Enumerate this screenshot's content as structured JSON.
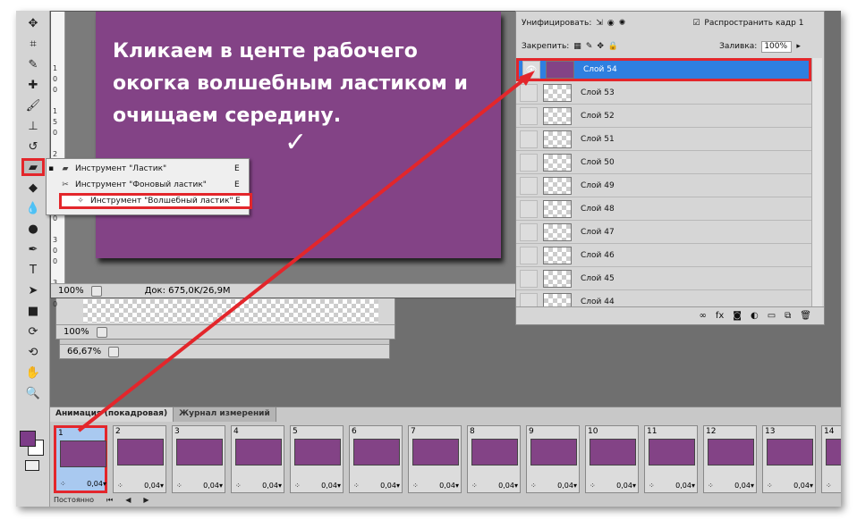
{
  "toolbox": {
    "tools": [
      {
        "name": "move-icon",
        "glyph": "✥"
      },
      {
        "name": "crop-icon",
        "glyph": "⌗"
      },
      {
        "name": "eyedropper-icon",
        "glyph": "✎"
      },
      {
        "name": "healing-brush-icon",
        "glyph": "✚"
      },
      {
        "name": "brush-icon",
        "glyph": "🖌"
      },
      {
        "name": "stamp-icon",
        "glyph": "⊥"
      },
      {
        "name": "history-brush-icon",
        "glyph": "↺"
      },
      {
        "name": "eraser-icon",
        "glyph": "▰",
        "selected": true
      },
      {
        "name": "paint-bucket-icon",
        "glyph": "◆"
      },
      {
        "name": "blur-icon",
        "glyph": "💧"
      },
      {
        "name": "dodge-icon",
        "glyph": "●"
      },
      {
        "name": "pen-icon",
        "glyph": "✒"
      },
      {
        "name": "type-icon",
        "glyph": "T"
      },
      {
        "name": "path-selection-icon",
        "glyph": "➤"
      },
      {
        "name": "rectangle-icon",
        "glyph": "■"
      },
      {
        "name": "3d-rotate-icon",
        "glyph": "⟳"
      },
      {
        "name": "3d-orbit-icon",
        "glyph": "⟲"
      },
      {
        "name": "hand-icon",
        "glyph": "✋"
      },
      {
        "name": "zoom-icon",
        "glyph": "🔍"
      }
    ]
  },
  "document": {
    "ruler_marks": [
      "1",
      "0",
      "0",
      "1",
      "5",
      "0",
      "2",
      "0",
      "0",
      "2",
      "5",
      "0",
      "3",
      "0",
      "0",
      "3",
      "5",
      "0"
    ],
    "zoom": "100%",
    "doc_info": "Док: 675,0K/26,9M",
    "doc2_zoom": "100%",
    "doc3_zoom": "66,67%"
  },
  "annotation": {
    "text": "Кликаем в центе рабочего окогка волшебным ластиком и очищаем середину.",
    "checkmark": "✓"
  },
  "flyout": {
    "items": [
      {
        "label": "Инструмент \"Ластик\"",
        "key": "E",
        "icon": "eraser-icon",
        "glyph": "▰",
        "current": true
      },
      {
        "label": "Инструмент \"Фоновый ластик\"",
        "key": "E",
        "icon": "background-eraser-icon",
        "glyph": "✂"
      },
      {
        "label": "Инструмент \"Волшебный ластик\"",
        "key": "E",
        "icon": "magic-eraser-icon",
        "glyph": "✧",
        "highlight": true
      }
    ]
  },
  "layers": {
    "unify_label": "Унифицировать:",
    "propagate_label": "Распространить кадр 1",
    "lock_label": "Закрепить:",
    "fill_label": "Заливка:",
    "fill_value": "100%",
    "items": [
      {
        "name": "Слой 54",
        "active": true
      },
      {
        "name": "Слой 53"
      },
      {
        "name": "Слой 52"
      },
      {
        "name": "Слой 51"
      },
      {
        "name": "Слой 50"
      },
      {
        "name": "Слой 49"
      },
      {
        "name": "Слой 48"
      },
      {
        "name": "Слой 47"
      },
      {
        "name": "Слой 46"
      },
      {
        "name": "Слой 45"
      },
      {
        "name": "Слой 44"
      }
    ]
  },
  "animation": {
    "tabs": [
      "Анимация (покадровая)",
      "Журнал измерений"
    ],
    "frames": [
      {
        "num": "1",
        "delay": "0,04"
      },
      {
        "num": "2",
        "delay": "0,04"
      },
      {
        "num": "3",
        "delay": "0,04"
      },
      {
        "num": "4",
        "delay": "0,04"
      },
      {
        "num": "5",
        "delay": "0,04"
      },
      {
        "num": "6",
        "delay": "0,04"
      },
      {
        "num": "7",
        "delay": "0,04"
      },
      {
        "num": "8",
        "delay": "0,04"
      },
      {
        "num": "9",
        "delay": "0,04"
      },
      {
        "num": "10",
        "delay": "0,04"
      },
      {
        "num": "11",
        "delay": "0,04"
      },
      {
        "num": "12",
        "delay": "0,04"
      },
      {
        "num": "13",
        "delay": "0,04"
      },
      {
        "num": "14",
        "delay": "0,04"
      }
    ],
    "loop_label": "Постоянно"
  },
  "colors": {
    "accent_red": "#e3262b",
    "canvas_purple": "#834386",
    "selection_blue": "#2f7fe0"
  }
}
